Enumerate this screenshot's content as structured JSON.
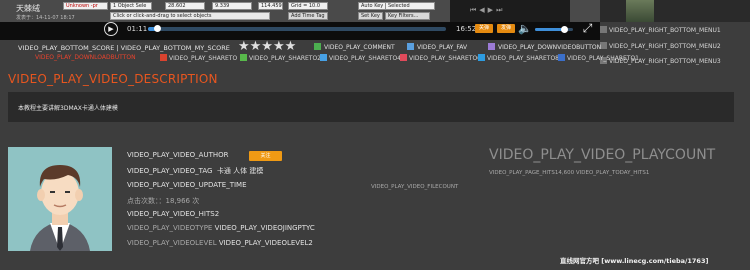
{
  "player": {
    "uploader_name": "天棘绒",
    "post_date": "发表于：14-11-07 18:17",
    "max_fields": [
      "Unknown -pr",
      "1 Object Sele",
      "28.602",
      "9.339",
      "114.459",
      "Grid = 10.0",
      "Auto Key",
      "Selected"
    ],
    "max_buttons": [
      "Add Time Tag",
      "Set Key",
      "Key Filters..."
    ],
    "max_hint": "Click or click-and-drag to select objects",
    "time_current": "01:11",
    "time_total": "16:52",
    "progress_fraction": 0.03,
    "volume_fraction": 0.75,
    "quality_btn_1": "关弹",
    "quality_btn_2": "发弹"
  },
  "right_menu": [
    "VIDEO_PLAY_RIGHT_BOTTOM_MENU1",
    "VIDEO_PLAY_RIGHT_BOTTOM_MENU2",
    "VIDEO_PLAY_RIGHT_BOTTOM_MENU3"
  ],
  "share_row": {
    "score_text": "VIDEO_PLAY_BOTTOM_SCORE | VIDEO_PLAY_BOTTOM_MY_SCORE",
    "stars": "★★★★★",
    "comment": "VIDEO_PLAY_COMMENT",
    "fav": "VIDEO_PLAY_FAV",
    "download_video": "VIDEO_PLAY_DOWNVIDEOBUTTON",
    "download_course": "VIDEO_PLAY_DOWNLOADBUTTON",
    "shares": [
      "VIDEO_PLAY_SHARETO",
      "VIDEO_PLAY_SHARETO2",
      "VIDEO_PLAY_SHARETO4",
      "VIDEO_PLAY_SHARETO6",
      "VIDEO_PLAY_SHARETO8",
      "VIDEO_PLAY_SHARETO1"
    ]
  },
  "description": {
    "title": "VIDEO_PLAY_VIDEO_DESCRIPTION",
    "text": "本教程主要讲解3DMAX卡通人体建模"
  },
  "author_card": {
    "author": "VIDEO_PLAY_VIDEO_AUTHOR",
    "follow_btn": "关注",
    "tag_label": "VIDEO_PLAY_VIDEO_TAG",
    "tags": "卡通  人体  建模",
    "update_time": "VIDEO_PLAY_VIDEO_UPDATE_TIME",
    "clicks": "点击次数：：18,966 次",
    "hits2": "VIDEO_PLAY_VIDEO_HITS2",
    "type_label": "VIDEO_PLAY_VIDEOTYPE",
    "type_value": "VIDEO_PLAY_VIDEOJINGPTYC",
    "level_label": "VIDEO_PLAY_VIDEOLEVEL",
    "level_value": "VIDEO_PLAY_VIDEOLEVEL2",
    "filecount": "VIDEO_PLAY_VIDEO_FILECOUNT",
    "playcount": "VIDEO_PLAY_VIDEO_PLAYCOUNT",
    "hits_row": "VIDEO_PLAY_PAGE_HITS14,600   VIDEO_PLAY_TODAY_HITS1"
  },
  "footer": "直线网官方吧 [www.linecg.com/tieba/1763]",
  "colors": {
    "accent": "#e8561f",
    "button": "#f09a14",
    "progress": "#3e8ed8"
  }
}
